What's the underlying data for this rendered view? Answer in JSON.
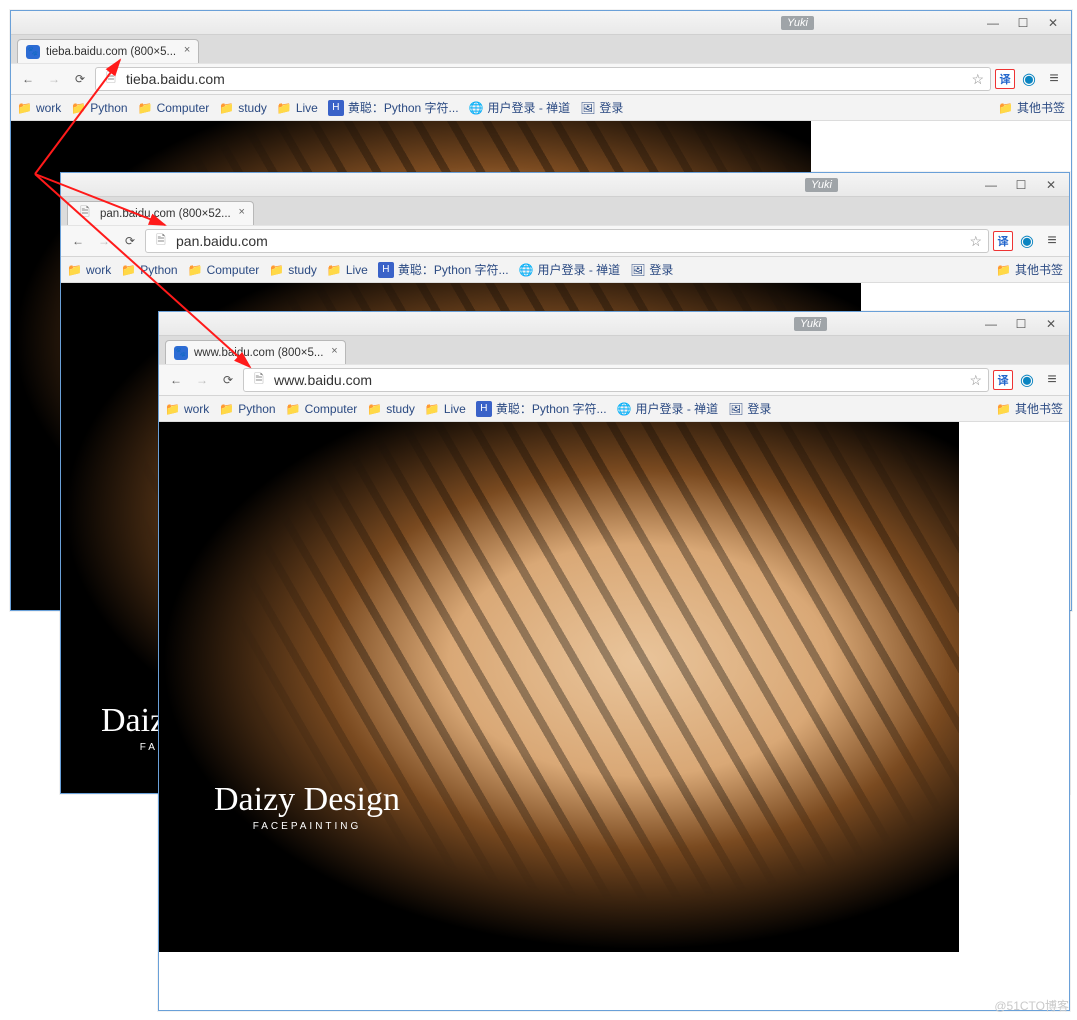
{
  "badge_label": "Yuki",
  "windows": [
    {
      "tab_title": "tieba.baidu.com (800×5...",
      "address": "tieba.baidu.com",
      "img_black_width": 800
    },
    {
      "tab_title": "pan.baidu.com (800×52...",
      "address": "pan.baidu.com",
      "img_black_width": 800
    },
    {
      "tab_title": "www.baidu.com (800×5...",
      "address": "www.baidu.com",
      "img_black_width": 800
    }
  ],
  "nav": {
    "back_title": "Back",
    "forward_title": "Forward",
    "reload_title": "Reload"
  },
  "toolbar": {
    "star_title": "Bookmark",
    "translate_label": "译",
    "menu_title": "Menu"
  },
  "bookmarks": {
    "folders": [
      "work",
      "Python",
      "Computer",
      "study",
      "Live"
    ],
    "huangcong": "黄聪：Python 字符...",
    "zentao": "用户登录 - 禅道",
    "login": "登录",
    "other": "其他书签"
  },
  "photo": {
    "brand_main": "Daizy Design",
    "brand_sub": "FACEPAINTING"
  },
  "watermark": "@51CTO博客"
}
